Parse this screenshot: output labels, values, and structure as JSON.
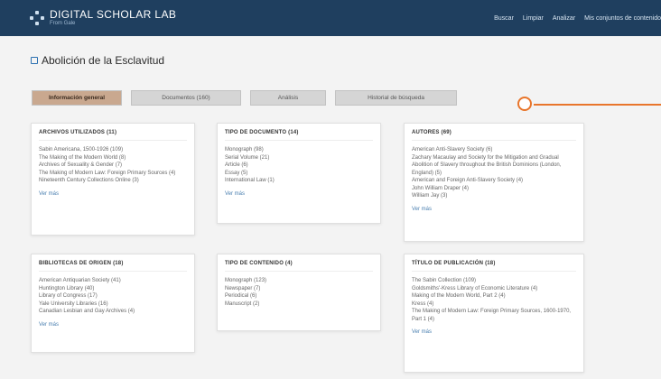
{
  "header": {
    "brand": "DIGITAL SCHOLAR LAB",
    "sub": "From Gale",
    "nav": [
      "Buscar",
      "Limpiar",
      "Analizar",
      "Mis conjuntos de contenido"
    ]
  },
  "page": {
    "title": "Abolición de la Esclavitud"
  },
  "tabs": [
    "Información general",
    "Documentos (160)",
    "Análisis",
    "Historial de búsqueda"
  ],
  "cards": [
    {
      "title": "ARCHIVOS UTILIZADOS (11)",
      "items": [
        "Sabin Americana, 1500-1926 (109)",
        "The Making of the Modern World (8)",
        "Archives of Sexuality & Gender (7)",
        "The Making of Modern Law: Foreign Primary Sources (4)",
        "Nineteenth Century Collections Online (3)"
      ],
      "more": "Ver más"
    },
    {
      "title": "TIPO DE DOCUMENTO (14)",
      "items": [
        "Monograph (98)",
        "Serial Volume (21)",
        "Article (6)",
        "Essay (5)",
        "International Law (1)"
      ],
      "more": "Ver más"
    },
    {
      "title": "AUTORES (69)",
      "items": [
        "American Anti-Slavery Society (6)",
        "Zachary Macaulay and Society for the Mitigation and Gradual Abolition of Slavery throughout the British Dominions (London, England) (5)",
        "American and Foreign Anti-Slavery Society (4)",
        "John William Draper (4)",
        "William Jay (3)"
      ],
      "more": "Ver más"
    },
    {
      "title": "BIBLIOTECAS DE ORIGEN (18)",
      "items": [
        "American Antiquarian Society (41)",
        "Huntington Library (40)",
        "Library of Congress (17)",
        "Yale University Libraries (16)",
        "Canadian Lesbian and Gay Archives (4)"
      ],
      "more": "Ver más"
    },
    {
      "title": "TIPO DE CONTENIDO (4)",
      "items": [
        "Monograph (123)",
        "Newspaper (7)",
        "Periodical (6)",
        "Manuscript (2)"
      ],
      "more": ""
    },
    {
      "title": "TÍTULO DE PUBLICACIÓN (18)",
      "items": [
        "The Sabin Collection (109)",
        "Goldsmiths'-Kress Library of Economic Literature (4)",
        "Making of the Modern World, Part 2 (4)",
        "Kress (4)",
        "The Making of Modern Law: Foreign Primary Sources, 1600-1970, Part 1 (4)"
      ],
      "more": "Ver más"
    }
  ]
}
